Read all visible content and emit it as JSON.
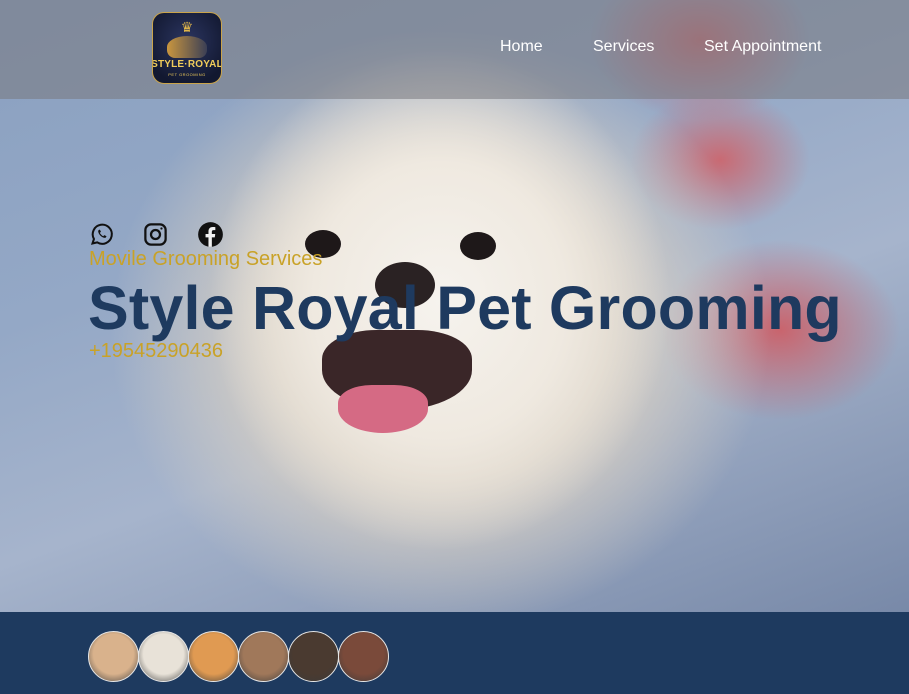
{
  "header": {
    "logo": {
      "title": "STYLE·ROYAL",
      "subtitle": "PET GROOMING"
    },
    "nav": [
      {
        "label": "Home"
      },
      {
        "label": "Services"
      },
      {
        "label": "Set Appointment"
      }
    ]
  },
  "hero": {
    "socials": [
      {
        "icon": "whatsapp-icon"
      },
      {
        "icon": "instagram-icon"
      },
      {
        "icon": "facebook-icon"
      }
    ],
    "tagline": "Movile Grooming Services",
    "title": "Style Royal Pet Grooming",
    "phone": "+19545290436"
  },
  "gallery": {
    "avatars": [
      {
        "subject": "french-bulldog",
        "color": "#d9b28c"
      },
      {
        "subject": "white-dog",
        "color": "#e8e2d8"
      },
      {
        "subject": "orange-cat",
        "color": "#e09a52"
      },
      {
        "subject": "tabby-cat",
        "color": "#a0785a"
      },
      {
        "subject": "black-tan-dog",
        "color": "#4a3a30"
      },
      {
        "subject": "shiba-dog",
        "color": "#7a4a3a"
      }
    ]
  },
  "colors": {
    "navy": "#1e3a5f",
    "gold": "#c9a227",
    "nav_text": "#ffffff"
  }
}
